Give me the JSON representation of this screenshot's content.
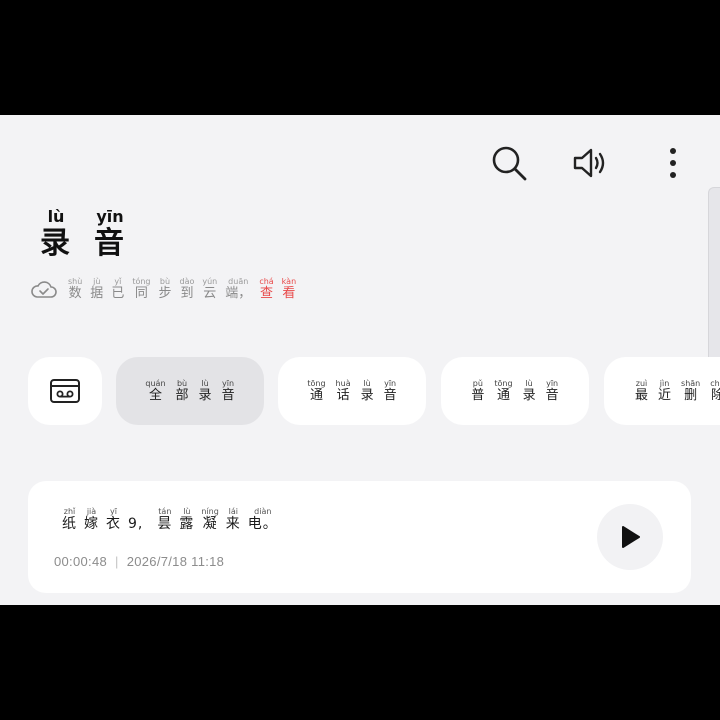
{
  "toolbar": {
    "search_icon": "search-icon",
    "speaker_icon": "speaker-icon",
    "more_icon": "more-vertical-icon"
  },
  "header": {
    "title": [
      {
        "char": "录",
        "pinyin": "lù"
      },
      {
        "char": "音",
        "pinyin": "yīn"
      }
    ]
  },
  "sync": {
    "icon": "cloud-check-icon",
    "text": [
      {
        "char": "数",
        "pinyin": "shù"
      },
      {
        "char": "据",
        "pinyin": "jù"
      },
      {
        "char": "已",
        "pinyin": "yǐ"
      },
      {
        "char": "同",
        "pinyin": "tóng"
      },
      {
        "char": "步",
        "pinyin": "bù"
      },
      {
        "char": "到",
        "pinyin": "dào"
      },
      {
        "char": "云",
        "pinyin": "yún"
      },
      {
        "char": "端，",
        "pinyin": "duān"
      }
    ],
    "link": [
      {
        "char": "查",
        "pinyin": "chá"
      },
      {
        "char": "看",
        "pinyin": "kàn"
      }
    ],
    "link_color": "#e84a4a"
  },
  "filters": {
    "icon": "cassette-tape-icon",
    "all": [
      {
        "char": "全",
        "pinyin": "quán"
      },
      {
        "char": "部",
        "pinyin": "bù"
      },
      {
        "char": "录",
        "pinyin": "lù"
      },
      {
        "char": "音",
        "pinyin": "yīn"
      }
    ],
    "call": [
      {
        "char": "通",
        "pinyin": "tōng"
      },
      {
        "char": "话",
        "pinyin": "huà"
      },
      {
        "char": "录",
        "pinyin": "lù"
      },
      {
        "char": "音",
        "pinyin": "yīn"
      }
    ],
    "normal": [
      {
        "char": "普",
        "pinyin": "pǔ"
      },
      {
        "char": "通",
        "pinyin": "tōng"
      },
      {
        "char": "录",
        "pinyin": "lù"
      },
      {
        "char": "音",
        "pinyin": "yīn"
      }
    ],
    "deleted": [
      {
        "char": "最",
        "pinyin": "zuì"
      },
      {
        "char": "近",
        "pinyin": "jìn"
      },
      {
        "char": "删",
        "pinyin": "shān"
      },
      {
        "char": "除",
        "pinyin": "chú"
      }
    ],
    "active": "all"
  },
  "recordings": [
    {
      "title": [
        {
          "char": "纸",
          "pinyin": "zhǐ"
        },
        {
          "char": "嫁",
          "pinyin": "jià"
        },
        {
          "char": "衣",
          "pinyin": "yī"
        },
        {
          "plain": "9,"
        },
        {
          "char": "昙",
          "pinyin": "tán"
        },
        {
          "char": "露",
          "pinyin": "lù"
        },
        {
          "char": "凝",
          "pinyin": "níng"
        },
        {
          "char": "来",
          "pinyin": "lái"
        },
        {
          "char": "电。",
          "pinyin": "diàn"
        }
      ],
      "duration": "00:00:48",
      "separator": "|",
      "timestamp": "2026/7/18  11:18",
      "play_icon": "play-icon"
    }
  ]
}
